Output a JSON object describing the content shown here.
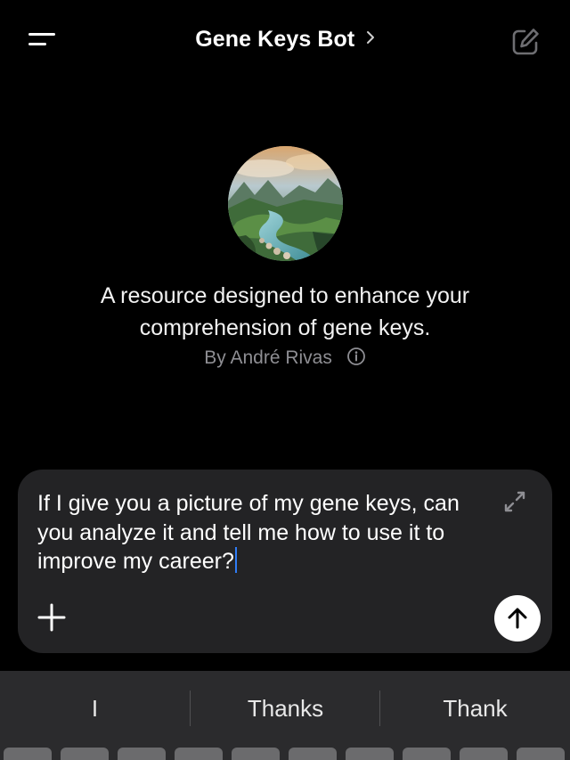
{
  "header": {
    "title": "Gene Keys Bot",
    "menu_icon": "menu-icon",
    "compose_icon": "compose-icon"
  },
  "bot": {
    "description": "A resource designed to enhance your comprehension of gene keys.",
    "byline": "By André Rivas",
    "info_icon": "info-icon"
  },
  "composer": {
    "text": "If I give you a picture of my gene keys, can you analyze it and tell me how to use it to improve my career?",
    "expand_icon": "expand-icon",
    "add_icon": "plus-icon",
    "send_icon": "arrow-up-icon"
  },
  "keyboard": {
    "suggestions": [
      "I",
      "Thanks",
      "Thank"
    ]
  },
  "colors": {
    "background": "#000000",
    "composer_bg": "#232325",
    "keyboard_bg": "#2b2b2d",
    "caret": "#2f7cf6",
    "secondary_text": "#8e8e93"
  }
}
